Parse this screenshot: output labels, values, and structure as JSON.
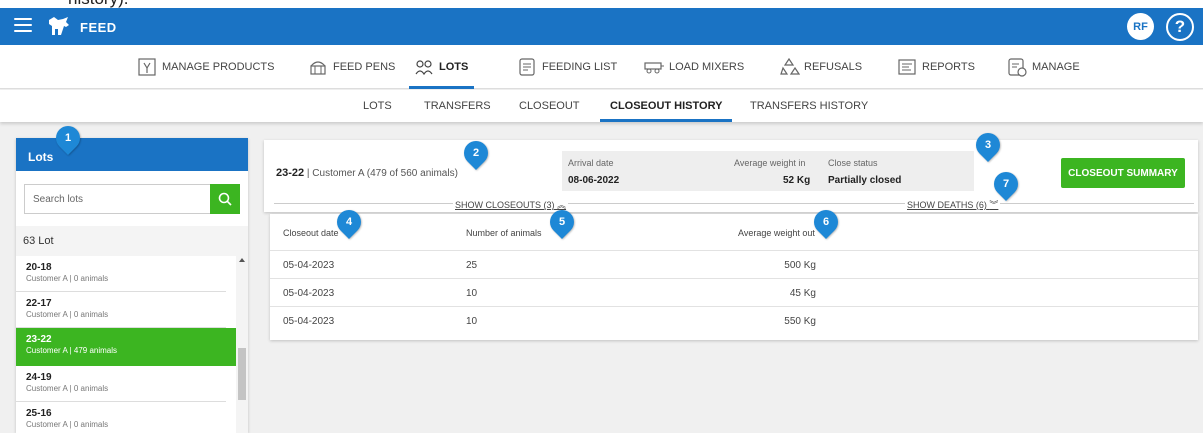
{
  "caption_text": "history).",
  "app": {
    "title": "FEED",
    "user_initials": "RF",
    "help_label": "?"
  },
  "main_nav": [
    {
      "label": "MANAGE PRODUCTS",
      "icon": "manage-products-icon"
    },
    {
      "label": "FEED PENS",
      "icon": "feed-pens-icon"
    },
    {
      "label": "LOTS",
      "icon": "lots-icon",
      "active": true
    },
    {
      "label": "FEEDING LIST",
      "icon": "feeding-list-icon"
    },
    {
      "label": "LOAD MIXERS",
      "icon": "load-mixers-icon"
    },
    {
      "label": "REFUSALS",
      "icon": "refusals-icon"
    },
    {
      "label": "REPORTS",
      "icon": "reports-icon"
    },
    {
      "label": "MANAGE",
      "icon": "manage-icon"
    }
  ],
  "sub_nav": [
    {
      "label": "LOTS"
    },
    {
      "label": "TRANSFERS"
    },
    {
      "label": "CLOSEOUT"
    },
    {
      "label": "CLOSEOUT HISTORY",
      "active": true
    },
    {
      "label": "TRANSFERS HISTORY"
    }
  ],
  "lots_panel": {
    "title": "Lots",
    "search_placeholder": "Search lots",
    "count_label": "63 Lot",
    "items": [
      {
        "code": "20-18",
        "sub": "Customer A | 0 animals"
      },
      {
        "code": "22-17",
        "sub": "Customer A | 0 animals"
      },
      {
        "code": "23-22",
        "sub": "Customer A | 479 animals",
        "selected": true
      },
      {
        "code": "24-19",
        "sub": "Customer A | 0 animals"
      },
      {
        "code": "25-16",
        "sub": "Customer A | 0 animals"
      }
    ]
  },
  "lot_detail": {
    "code": "23-22",
    "customer_info": " | Customer A (479 of 560 animals)",
    "arrival_label": "Arrival date",
    "arrival_value": "08-06-2022",
    "avg_weight_in_label": "Average weight in",
    "avg_weight_in_value": "52 Kg",
    "close_status_label": "Close status",
    "close_status_value": "Partially closed",
    "summary_button": "CLOSEOUT SUMMARY",
    "show_closeouts": "SHOW CLOSEOUTS (3)",
    "show_deaths": "SHOW DEATHS (6)"
  },
  "closeouts_table": {
    "headers": [
      "Closeout date",
      "Number of animals",
      "Average weight out"
    ],
    "rows": [
      [
        "05-04-2023",
        "25",
        "500 Kg"
      ],
      [
        "05-04-2023",
        "10",
        "45 Kg"
      ],
      [
        "05-04-2023",
        "10",
        "550 Kg"
      ]
    ]
  },
  "markers": [
    "1",
    "2",
    "3",
    "4",
    "5",
    "6",
    "7"
  ],
  "colors": {
    "primary": "#1a73c4",
    "accent_green": "#3cb521",
    "marker": "#1e88d6"
  }
}
